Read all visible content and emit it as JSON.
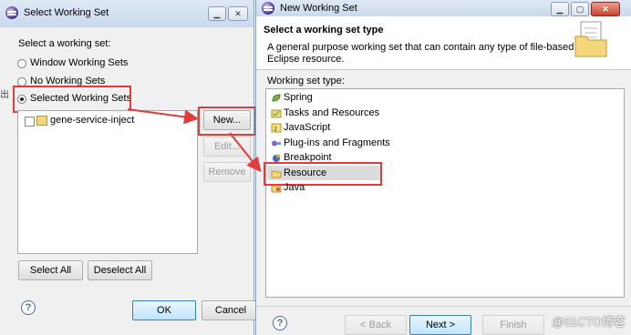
{
  "left_dialog": {
    "title": "Select Working Set",
    "prompt": "Select a working set:",
    "radio_window": "Window Working Sets",
    "radio_none": "No Working Sets",
    "radio_selected": "Selected Working Sets",
    "list_item": "gene-service-inject",
    "btn_new": "New...",
    "btn_edit": "Edit...",
    "btn_remove": "Remove",
    "btn_select_all": "Select All",
    "btn_deselect_all": "Deselect All",
    "btn_ok": "OK",
    "btn_cancel": "Cancel",
    "help": "?"
  },
  "right_dialog": {
    "title": "New Working Set",
    "header_title": "Select a working set type",
    "header_desc_1": "A general purpose working set that can contain any type of file-based",
    "header_desc_2": "Eclipse resource.",
    "type_label": "Working set type:",
    "types": [
      "Spring",
      "Tasks and Resources",
      "JavaScript",
      "Plug-ins and Fragments",
      "Breakpoint",
      "Resource",
      "Java"
    ],
    "btn_back": "< Back",
    "btn_next": "Next >",
    "btn_finish": "Finish",
    "help": "?"
  },
  "watermark": "@51CTO博客",
  "edge_glyph": "出",
  "colors": {
    "highlight_red": "#e23b3b",
    "selection": "#dcdcdc"
  }
}
